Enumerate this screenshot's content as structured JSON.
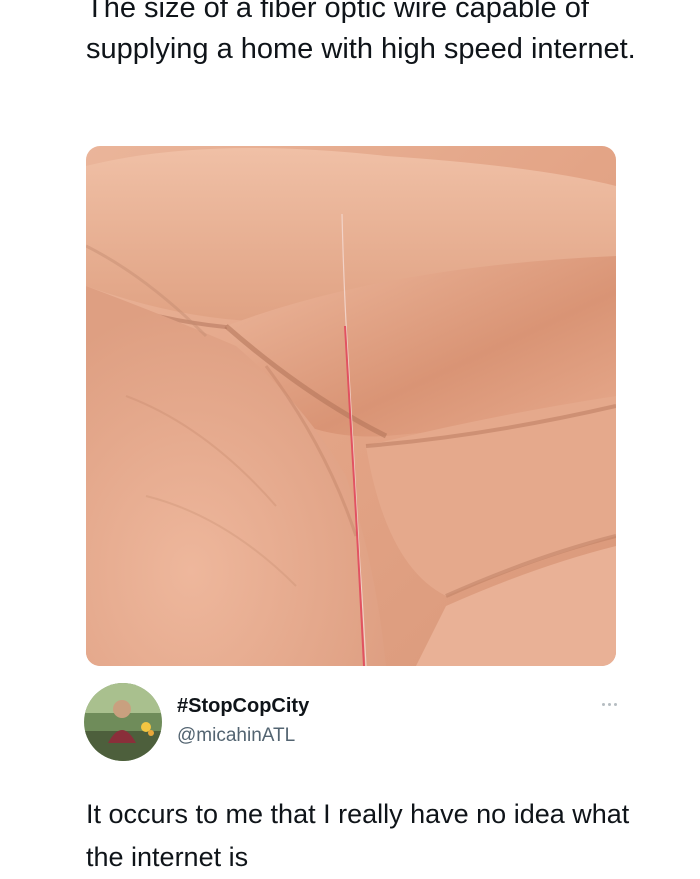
{
  "quoted": {
    "text": "The size of a fiber optic wire capable of supplying a home with high speed internet."
  },
  "author": {
    "display_name": "#StopCopCity",
    "handle": "@micahinATL"
  },
  "tweet": {
    "text": "It occurs to me that I really have no idea what the internet is"
  },
  "colors": {
    "text_primary": "#0f1419",
    "text_secondary": "#536471",
    "fiber": "#e0445a",
    "skin": "#e8a88a"
  },
  "icons": {
    "more": "more-options-icon"
  }
}
